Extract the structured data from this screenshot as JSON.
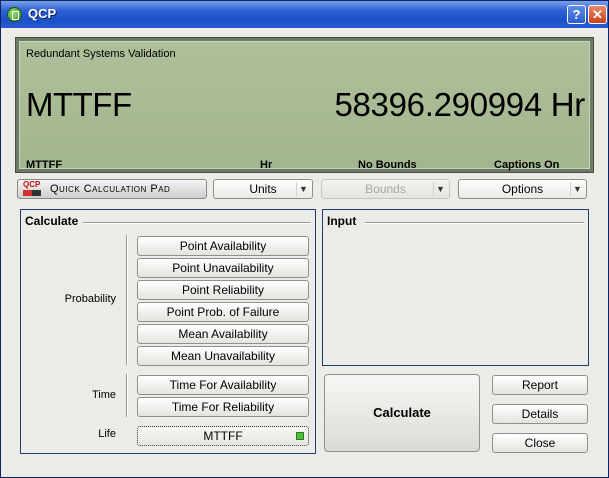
{
  "window": {
    "title": "QCP"
  },
  "display": {
    "subtitle": "Redundant Systems Validation",
    "metric": "MTTFF",
    "value": "58396.290994 Hr",
    "status": {
      "metric": "MTTFF",
      "units": "Hr",
      "bounds": "No Bounds",
      "captions": "Captions On"
    }
  },
  "toolbar": {
    "logo_badge": "QCP",
    "logo_text": "Quick Calculation Pad",
    "units_label": "Units",
    "bounds_label": "Bounds",
    "options_label": "Options"
  },
  "calculate_panel": {
    "title": "Calculate",
    "groups": {
      "probability": {
        "label": "Probability",
        "buttons": [
          "Point Availability",
          "Point Unavailability",
          "Point Reliability",
          "Point Prob. of Failure",
          "Mean Availability",
          "Mean Unavailability"
        ]
      },
      "time": {
        "label": "Time",
        "buttons": [
          "Time For Availability",
          "Time For Reliability"
        ]
      },
      "life": {
        "label": "Life",
        "buttons": [
          "MTTFF"
        ]
      }
    }
  },
  "input_panel": {
    "title": "Input"
  },
  "actions": {
    "calculate": "Calculate",
    "report": "Report",
    "details": "Details",
    "close": "Close"
  },
  "colors": {
    "lcd": "#a8b993",
    "titlebar": "#1b4fc7",
    "panel_border": "#1c3f7a",
    "led": "#4cc23a"
  }
}
